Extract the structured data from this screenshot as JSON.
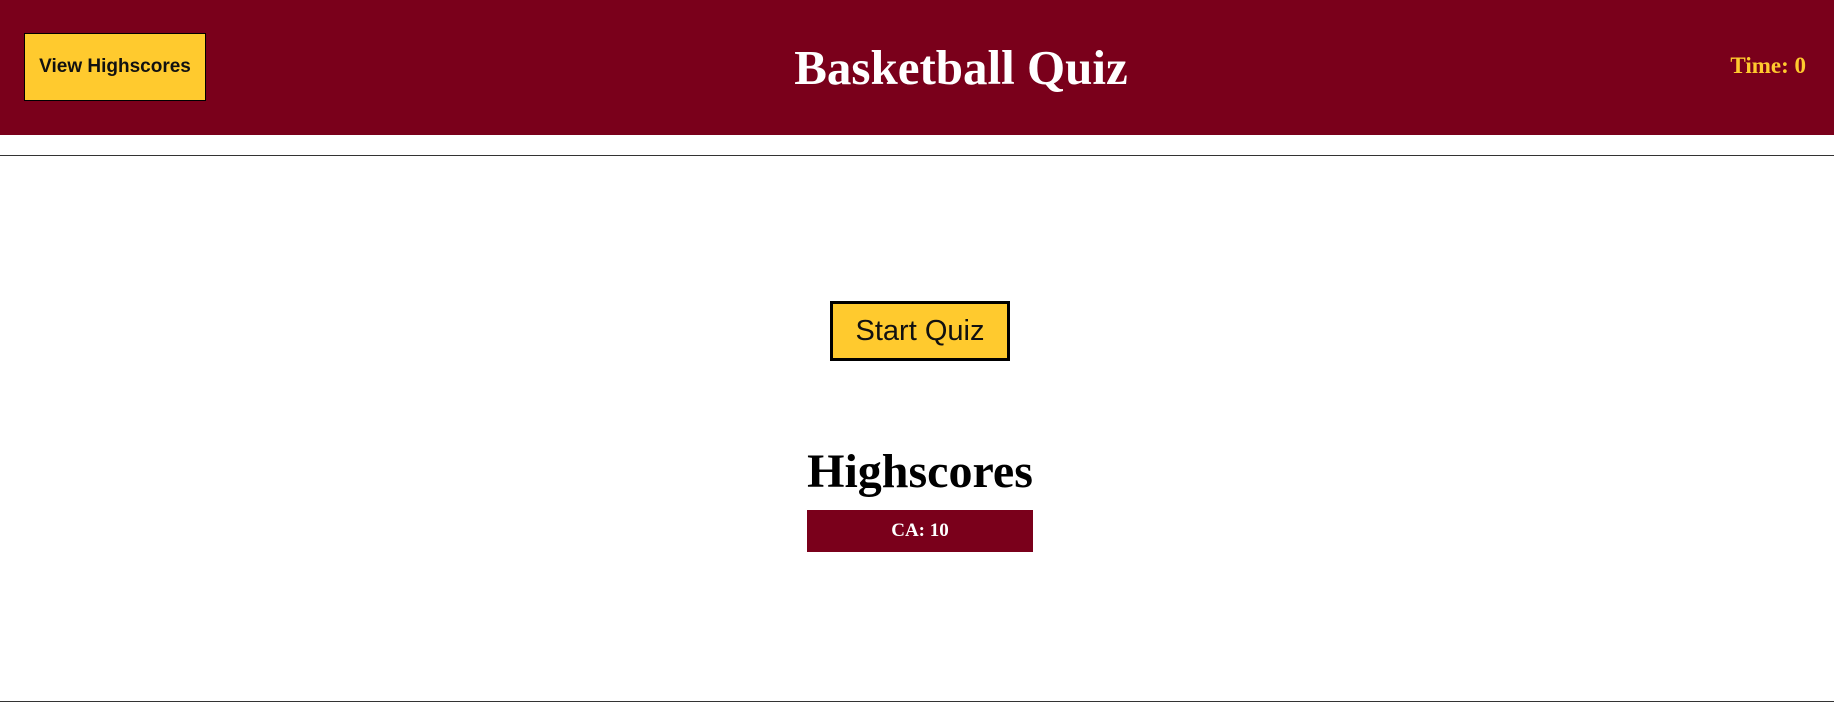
{
  "header": {
    "view_highscores_label": "View Highscores",
    "title": "Basketball Quiz",
    "timer": "Time: 0"
  },
  "main": {
    "start_label": "Start Quiz",
    "highscores_heading": "Highscores",
    "highscores": [
      {
        "entry": "CA: 10"
      }
    ]
  },
  "colors": {
    "brand": "#7a001b",
    "accent": "#ffca2e",
    "text_light": "#ffffff"
  }
}
